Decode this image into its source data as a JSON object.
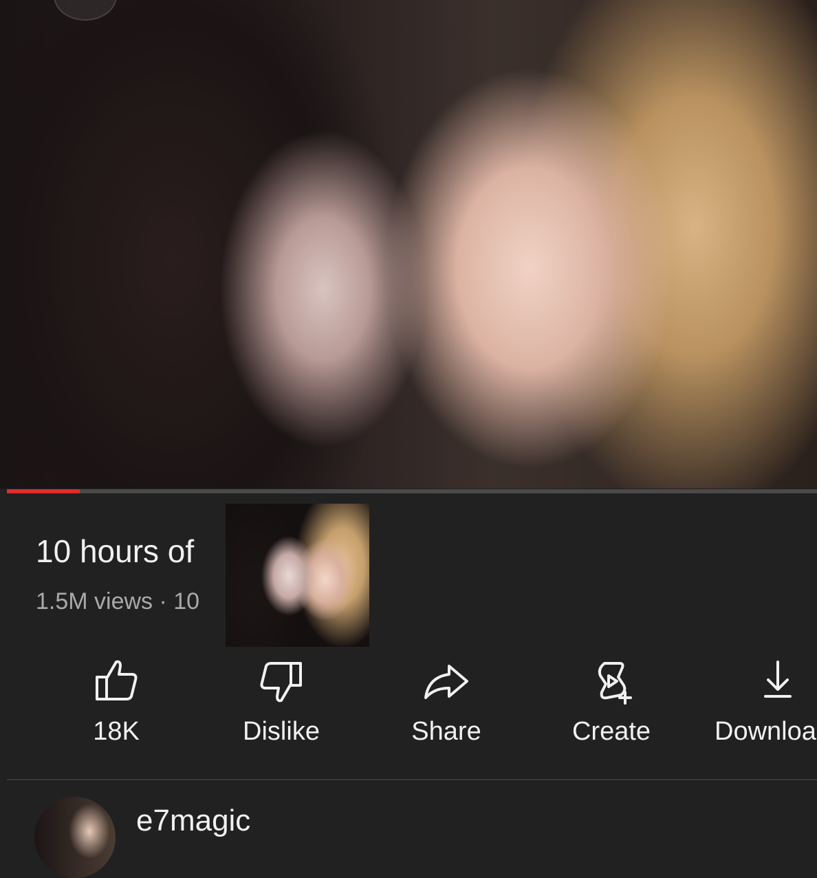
{
  "video": {
    "title": "10 hours of",
    "meta": "1.5M views · 10",
    "progress_fraction": 0.09,
    "accent_color": "#e22b2b"
  },
  "actions": [
    {
      "label": "18K",
      "icon": "thumbs-up-icon"
    },
    {
      "label": "Dislike",
      "icon": "thumbs-down-icon"
    },
    {
      "label": "Share",
      "icon": "share-arrow-icon"
    },
    {
      "label": "Create",
      "icon": "create-remix-icon"
    },
    {
      "label": "Downloa",
      "icon": "download-icon"
    }
  ],
  "channel": {
    "name": "e7magic"
  }
}
